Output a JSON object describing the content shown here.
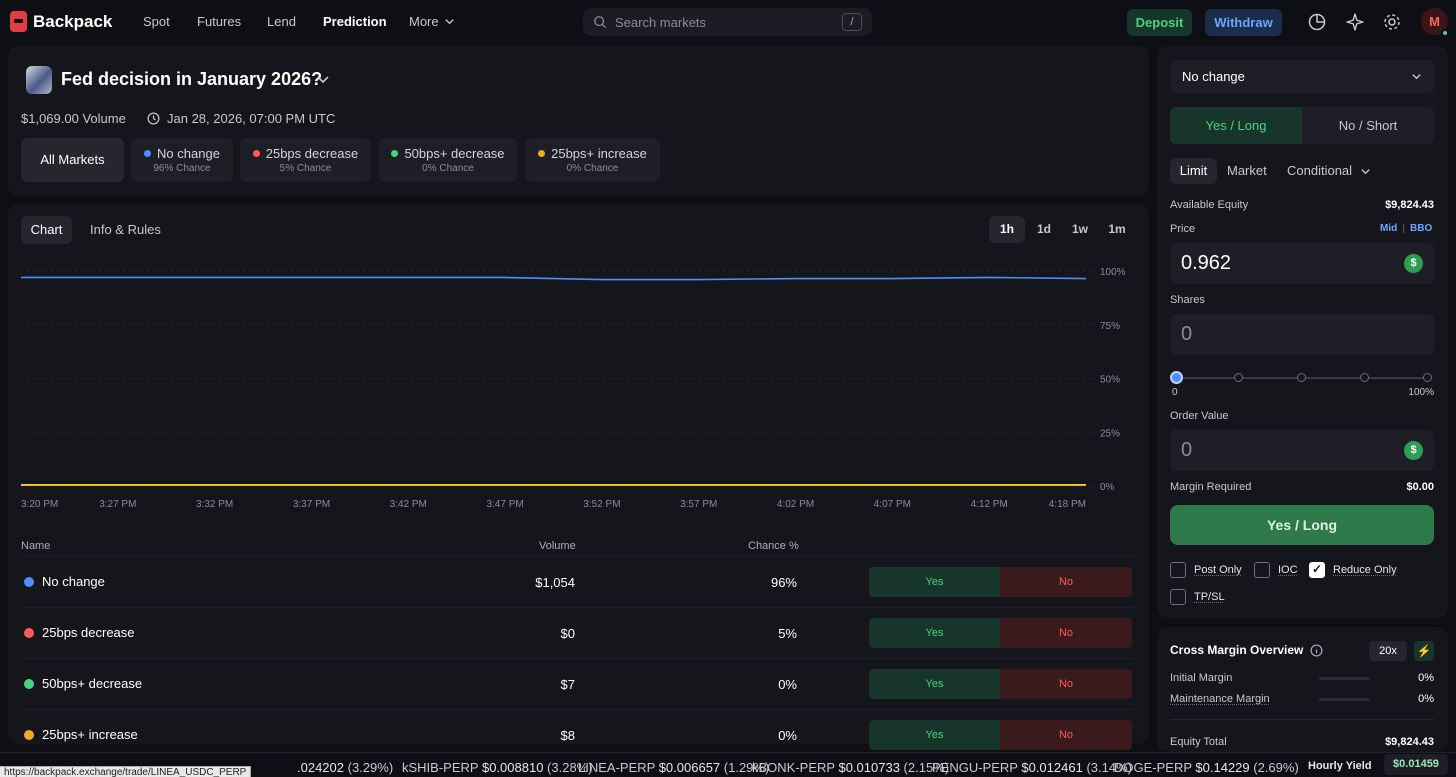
{
  "brand": {
    "name": "Backpack"
  },
  "nav": {
    "items": [
      "Spot",
      "Futures",
      "Lend",
      "Prediction",
      "More"
    ],
    "active": "Prediction"
  },
  "search": {
    "placeholder": "Search markets",
    "shortcut": "/"
  },
  "actions": {
    "deposit": "Deposit",
    "withdraw": "Withdraw"
  },
  "user": {
    "avatar_initial": "M"
  },
  "market": {
    "title": "Fed decision in January 2026?",
    "volume": "$1,069.00 Volume",
    "date": "Jan 28, 2026, 07:00 PM UTC",
    "all_markets": "All Markets",
    "outcomes": [
      {
        "name": "No change",
        "chance": "96% Chance",
        "color": "#4c8dff"
      },
      {
        "name": "25bps decrease",
        "chance": "5% Chance",
        "color": "#ff5b5b"
      },
      {
        "name": "50bps+ decrease",
        "chance": "0% Chance",
        "color": "#4ad37f"
      },
      {
        "name": "25bps+ increase",
        "chance": "0% Chance",
        "color": "#f5a623"
      }
    ]
  },
  "tabs": {
    "chart": "Chart",
    "info": "Info & Rules"
  },
  "timeframes": [
    "1h",
    "1d",
    "1w",
    "1m"
  ],
  "timeframe_active": "1h",
  "chart_data": {
    "type": "line",
    "x": [
      "3:20 PM",
      "3:27 PM",
      "3:32 PM",
      "3:37 PM",
      "3:42 PM",
      "3:47 PM",
      "3:52 PM",
      "3:57 PM",
      "4:02 PM",
      "4:07 PM",
      "4:12 PM",
      "4:18 PM"
    ],
    "ylim": [
      0,
      100
    ],
    "y_ticks": [
      "100%",
      "75%",
      "50%",
      "25%",
      "0%"
    ],
    "grid": true,
    "series": [
      {
        "color": "#4c8dff",
        "values": [
          97,
          97,
          97,
          97,
          97,
          97,
          96,
          96,
          96.5,
          96.5,
          97,
          96.5
        ]
      },
      {
        "color": "#f5d020",
        "values": [
          0.5,
          0.5,
          0.5,
          0.5,
          0.5,
          0.5,
          0.5,
          0.5,
          0.5,
          0.5,
          0.5,
          0.5
        ]
      }
    ]
  },
  "table": {
    "headers": {
      "name": "Name",
      "volume": "Volume",
      "chance": "Chance %"
    },
    "yes_label": "Yes",
    "no_label": "No",
    "rows": [
      {
        "name": "No change",
        "volume": "$1,054",
        "chance": "96%",
        "color": "#4c8dff"
      },
      {
        "name": "25bps decrease",
        "volume": "$0",
        "chance": "5%",
        "color": "#ff5b5b"
      },
      {
        "name": "50bps+ decrease",
        "volume": "$7",
        "chance": "0%",
        "color": "#4ad37f"
      },
      {
        "name": "25bps+ increase",
        "volume": "$8",
        "chance": "0%",
        "color": "#f5a623"
      }
    ]
  },
  "order": {
    "selected_outcome": "No change",
    "side_yes": "Yes / Long",
    "side_no": "No / Short",
    "types": [
      "Limit",
      "Market",
      "Conditional"
    ],
    "type_active": "Limit",
    "available_equity_label": "Available Equity",
    "available_equity": "$9,824.43",
    "price_label": "Price",
    "mid": "Mid",
    "bbo": "BBO",
    "price": "0.962",
    "shares_label": "Shares",
    "shares": "0",
    "slider_min": "0",
    "slider_max": "100%",
    "slider_value": 0,
    "order_value_label": "Order Value",
    "order_value": "0",
    "margin_required_label": "Margin Required",
    "margin_required": "$0.00",
    "submit": "Yes / Long",
    "post_only": "Post Only",
    "ioc": "IOC",
    "reduce_only": "Reduce Only",
    "tpsl": "TP/SL",
    "reduce_only_checked": true
  },
  "cross_margin": {
    "title": "Cross Margin Overview",
    "leverage": "20x",
    "initial_margin_label": "Initial Margin",
    "initial_margin": "0%",
    "maintenance_margin_label": "Maintenance Margin",
    "maintenance_margin": "0%",
    "equity_total_label": "Equity Total",
    "equity_total": "$9,824.43"
  },
  "ticker": {
    "items": [
      {
        "name": "",
        "price": ".024202",
        "change": "(3.29%)"
      },
      {
        "name": "kSHIB-PERP",
        "price": "$0.008810",
        "change": "(3.28%)"
      },
      {
        "name": "LINEA-PERP",
        "price": "$0.006657",
        "change": "(1.29%)"
      },
      {
        "name": "kBONK-PERP",
        "price": "$0.010733",
        "change": "(2.15%)"
      },
      {
        "name": "PENGU-PERP",
        "price": "$0.012461",
        "change": "(3.14%)"
      },
      {
        "name": "DOGE-PERP",
        "price": "$0.14229",
        "change": "(2.69%)"
      }
    ],
    "hourly_yield_label": "Hourly Yield",
    "hourly_yield": "$0.01459"
  },
  "status_url": "https://backpack.exchange/trade/LINEA_USDC_PERP"
}
